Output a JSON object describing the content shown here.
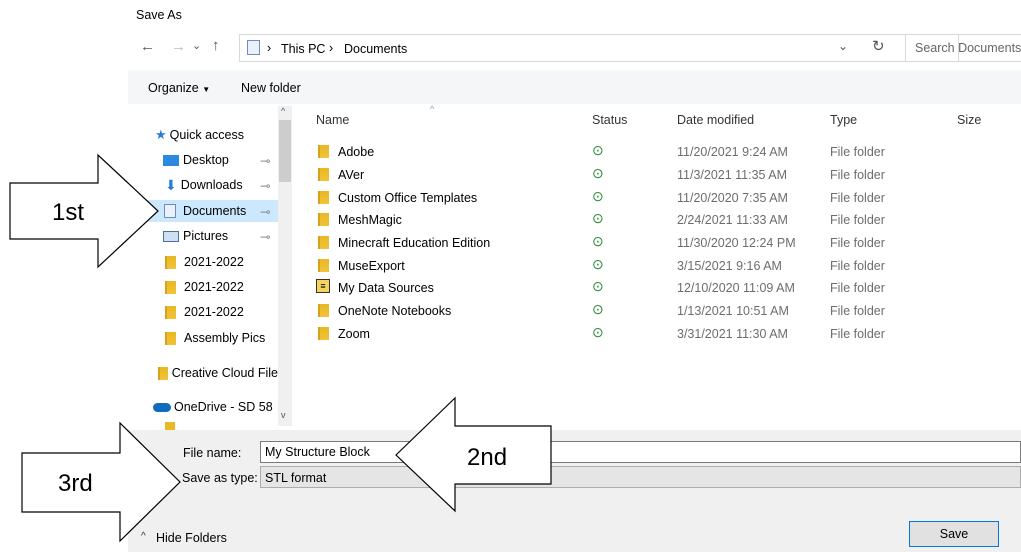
{
  "window": {
    "title": "Save As"
  },
  "nav": {
    "back_icon": "arrow-left-icon",
    "forward_icon": "arrow-right-icon",
    "history_icon": "chevron-down-icon",
    "up_icon": "arrow-up-icon",
    "breadcrumb": [
      "This PC",
      "Documents"
    ],
    "refresh_icon": "refresh-icon",
    "search_placeholder": "Search Documents"
  },
  "toolbar": {
    "organize_label": "Organize",
    "new_folder_label": "New folder"
  },
  "sidebar": {
    "items": [
      {
        "label": "Quick access",
        "icon": "star-icon"
      },
      {
        "label": "Desktop",
        "icon": "desktop-icon",
        "pinned": true
      },
      {
        "label": "Downloads",
        "icon": "download-icon",
        "pinned": true
      },
      {
        "label": "Documents",
        "icon": "documents-icon",
        "pinned": true,
        "selected": true
      },
      {
        "label": "Pictures",
        "icon": "pictures-icon",
        "pinned": true
      },
      {
        "label": "2021-2022",
        "icon": "folder-icon"
      },
      {
        "label": "2021-2022",
        "icon": "folder-icon"
      },
      {
        "label": "2021-2022",
        "icon": "folder-icon"
      },
      {
        "label": "Assembly Pics",
        "icon": "folder-icon"
      },
      {
        "label": "Creative Cloud File",
        "icon": "creative-cloud-icon"
      },
      {
        "label": "OneDrive - SD 58",
        "icon": "onedrive-icon"
      }
    ]
  },
  "file_list": {
    "columns": [
      "Name",
      "Status",
      "Date modified",
      "Type",
      "Size"
    ],
    "rows": [
      {
        "name": "Adobe",
        "date": "11/20/2021 9:24 AM",
        "type": "File folder"
      },
      {
        "name": "AVer",
        "date": "11/3/2021 11:35 AM",
        "type": "File folder"
      },
      {
        "name": "Custom Office Templates",
        "date": "11/20/2020 7:35 AM",
        "type": "File folder"
      },
      {
        "name": "MeshMagic",
        "date": "2/24/2021 11:33 AM",
        "type": "File folder"
      },
      {
        "name": "Minecraft Education Edition",
        "date": "11/30/2020 12:24 PM",
        "type": "File folder"
      },
      {
        "name": "MuseExport",
        "date": "3/15/2021 9:16 AM",
        "type": "File folder"
      },
      {
        "name": "My Data Sources",
        "date": "12/10/2020 11:09 AM",
        "type": "File folder"
      },
      {
        "name": "OneNote Notebooks",
        "date": "1/13/2021 10:51 AM",
        "type": "File folder"
      },
      {
        "name": "Zoom",
        "date": "3/31/2021 11:30 AM",
        "type": "File folder"
      }
    ],
    "status_icon": "synced-check-icon"
  },
  "form": {
    "filename_label": "File name:",
    "filename_value": "My Structure Block",
    "savetype_label": "Save as type:",
    "savetype_value": "STL format"
  },
  "footer": {
    "hide_folders_label": "Hide Folders",
    "save_label": "Save"
  },
  "annotations": {
    "first": "1st",
    "second": "2nd",
    "third": "3rd"
  },
  "colors": {
    "selection": "#cce8ff",
    "accent": "#0078d7",
    "folder": "#e8b923",
    "status_green": "#2e8b3a"
  }
}
